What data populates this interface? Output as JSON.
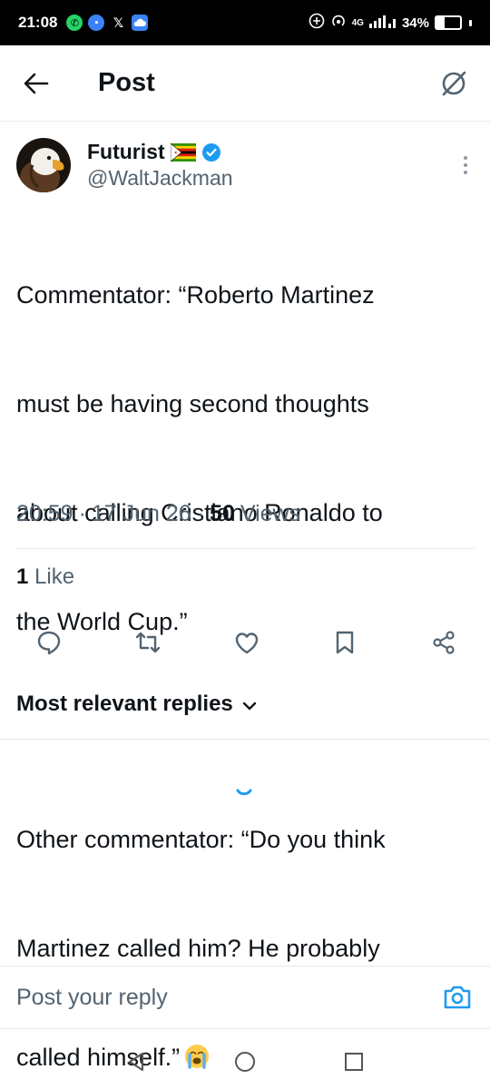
{
  "status_bar": {
    "time": "21:08",
    "network": "4G",
    "battery_percent": "34%",
    "battery_level": 0.34,
    "icons": [
      "whatsapp-icon",
      "messages-icon",
      "x-icon",
      "cloud-icon",
      "data-saver-icon",
      "hotspot-icon",
      "signal-icon",
      "battery-icon"
    ]
  },
  "header": {
    "title": "Post",
    "icons": [
      "back-arrow-icon",
      "grok-icon"
    ]
  },
  "author": {
    "name": "Futurist",
    "handle": "@WaltJackman",
    "verified": true,
    "icons": [
      "avatar-eagle",
      "zimbabwe-flag-icon",
      "verified-badge-icon",
      "more-options-icon"
    ]
  },
  "post": {
    "lines": [
      "Commentator: “Roberto Martinez",
      "must be having second thoughts",
      "about calling Cristiano Ronaldo to",
      "the World Cup.”",
      "",
      "Other commentator: “Do you think",
      "Martinez called him? He probably",
      "called himself.”"
    ],
    "emoji": "loudly-crying-face-emoji",
    "time": "20:59",
    "date": "17 Jun 26",
    "separator": "·",
    "views_count": "50",
    "views_label": "Views"
  },
  "engagement": {
    "likes_count": "1",
    "likes_label": "Like"
  },
  "actions": [
    "reply-icon",
    "repost-icon",
    "like-icon",
    "bookmark-icon",
    "share-icon"
  ],
  "replies": {
    "sort_label": "Most relevant replies"
  },
  "composer": {
    "placeholder": "Post your reply",
    "icon": "camera-icon"
  },
  "nav": [
    "back-nav-icon",
    "home-nav-icon",
    "recents-nav-icon"
  ],
  "colors": {
    "text": "#0f1419",
    "secondary": "#536471",
    "accent": "#1d9bf0",
    "divider": "#e6e9ea"
  }
}
